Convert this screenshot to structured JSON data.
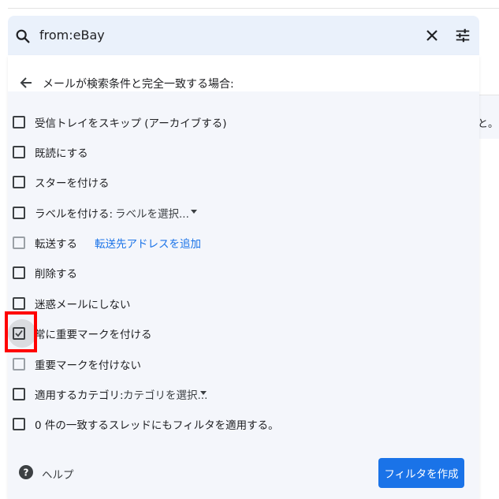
{
  "search": {
    "query": "from:eBay"
  },
  "panel": {
    "title": "メールが検索条件と完全一致する場合:",
    "options": [
      {
        "label": "受信トレイをスキップ (アーカイブする)",
        "checked": false,
        "disabled": false
      },
      {
        "label": "既読にする",
        "checked": false,
        "disabled": false
      },
      {
        "label": "スターを付ける",
        "checked": false,
        "disabled": false
      },
      {
        "label": "ラベルを付ける:",
        "dropdown": "ラベルを選択...",
        "checked": false,
        "disabled": false
      },
      {
        "label": "転送する",
        "link": "転送先アドレスを追加",
        "checked": false,
        "disabled": true
      },
      {
        "label": "削除する",
        "checked": false,
        "disabled": false
      },
      {
        "label": "迷惑メールにしない",
        "checked": false,
        "disabled": false
      },
      {
        "label": "常に重要マークを付ける",
        "checked": true,
        "disabled": false
      },
      {
        "label": "重要マークを付けない",
        "checked": false,
        "disabled": true
      },
      {
        "label": "適用するカテゴリ:",
        "dropdown": "カテゴリを選択...",
        "checked": false,
        "disabled": false
      },
      {
        "label": "0 件の一致するスレッドにもフィルタを適用する。",
        "checked": false,
        "disabled": false
      }
    ]
  },
  "right_edge_text": "と。",
  "footer": {
    "help_label": "ヘルプ",
    "create_button": "フィルタを作成"
  },
  "colors": {
    "accent": "#1a73e8",
    "search_bg": "#eaf1fb",
    "panel_bg": "#f4f6fb",
    "highlight": "#ff0000"
  }
}
